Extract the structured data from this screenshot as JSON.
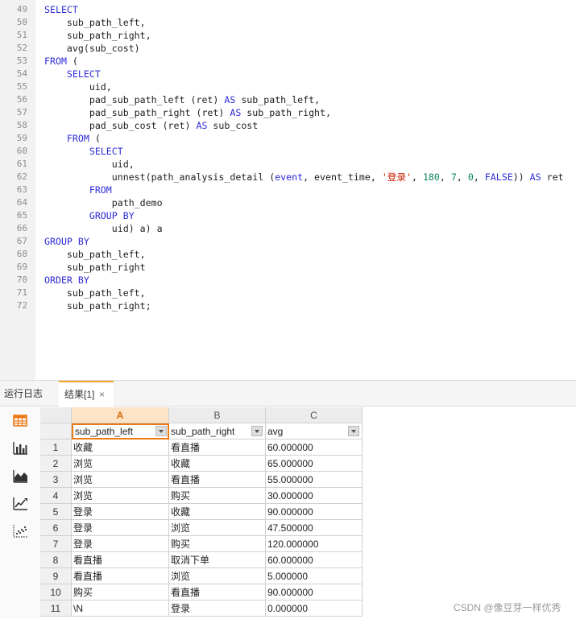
{
  "editor": {
    "lines": [
      {
        "no": "49",
        "segs": [
          {
            "t": "SELECT",
            "c": "kw"
          }
        ]
      },
      {
        "no": "50",
        "segs": [
          {
            "t": "    sub_path_left,"
          }
        ]
      },
      {
        "no": "51",
        "segs": [
          {
            "t": "    sub_path_right,"
          }
        ]
      },
      {
        "no": "52",
        "segs": [
          {
            "t": "    avg(sub_cost)"
          }
        ]
      },
      {
        "no": "53",
        "segs": [
          {
            "t": "FROM",
            "c": "kw"
          },
          {
            "t": " ("
          }
        ]
      },
      {
        "no": "54",
        "segs": [
          {
            "t": "    "
          },
          {
            "t": "SELECT",
            "c": "kw"
          }
        ]
      },
      {
        "no": "55",
        "segs": [
          {
            "t": "        uid,"
          }
        ]
      },
      {
        "no": "56",
        "segs": [
          {
            "t": "        pad_sub_path_left (ret) "
          },
          {
            "t": "AS",
            "c": "kw"
          },
          {
            "t": " sub_path_left,"
          }
        ]
      },
      {
        "no": "57",
        "segs": [
          {
            "t": "        pad_sub_path_right (ret) "
          },
          {
            "t": "AS",
            "c": "kw"
          },
          {
            "t": " sub_path_right,"
          }
        ]
      },
      {
        "no": "58",
        "segs": [
          {
            "t": "        pad_sub_cost (ret) "
          },
          {
            "t": "AS",
            "c": "kw"
          },
          {
            "t": " sub_cost"
          }
        ]
      },
      {
        "no": "59",
        "segs": [
          {
            "t": "    "
          },
          {
            "t": "FROM",
            "c": "kw"
          },
          {
            "t": " ("
          }
        ]
      },
      {
        "no": "60",
        "segs": [
          {
            "t": "        "
          },
          {
            "t": "SELECT",
            "c": "kw"
          }
        ]
      },
      {
        "no": "61",
        "segs": [
          {
            "t": "            uid,"
          }
        ]
      },
      {
        "no": "62",
        "segs": [
          {
            "t": "            unnest(path_analysis_detail ("
          },
          {
            "t": "event",
            "c": "kw"
          },
          {
            "t": ", event_time, "
          },
          {
            "t": "'登录'",
            "c": "str"
          },
          {
            "t": ", "
          },
          {
            "t": "180",
            "c": "num"
          },
          {
            "t": ", "
          },
          {
            "t": "7",
            "c": "num"
          },
          {
            "t": ", "
          },
          {
            "t": "0",
            "c": "num"
          },
          {
            "t": ", "
          },
          {
            "t": "FALSE",
            "c": "kw"
          },
          {
            "t": ")) "
          },
          {
            "t": "AS",
            "c": "kw"
          },
          {
            "t": " ret"
          }
        ]
      },
      {
        "no": "63",
        "segs": [
          {
            "t": "        "
          },
          {
            "t": "FROM",
            "c": "kw"
          }
        ]
      },
      {
        "no": "64",
        "segs": [
          {
            "t": "            path_demo"
          }
        ]
      },
      {
        "no": "65",
        "segs": [
          {
            "t": "        "
          },
          {
            "t": "GROUP BY",
            "c": "kw"
          }
        ]
      },
      {
        "no": "66",
        "segs": [
          {
            "t": "            uid) a) a"
          }
        ]
      },
      {
        "no": "67",
        "segs": [
          {
            "t": "GROUP BY",
            "c": "kw"
          }
        ]
      },
      {
        "no": "68",
        "segs": [
          {
            "t": "    sub_path_left,"
          }
        ]
      },
      {
        "no": "69",
        "segs": [
          {
            "t": "    sub_path_right"
          }
        ]
      },
      {
        "no": "70",
        "segs": [
          {
            "t": "ORDER BY",
            "c": "kw"
          }
        ]
      },
      {
        "no": "71",
        "segs": [
          {
            "t": "    sub_path_left,"
          }
        ]
      },
      {
        "no": "72",
        "segs": [
          {
            "t": "    sub_path_right;"
          }
        ]
      }
    ]
  },
  "tabs": {
    "log_label": "运行日志",
    "result_label": "结果[1]",
    "close_glyph": "×"
  },
  "sidebar": {
    "icons": [
      "table-icon",
      "bar-chart-icon",
      "area-chart-icon",
      "line-chart-icon",
      "scatter-chart-icon"
    ]
  },
  "grid": {
    "col_letters": [
      "A",
      "B",
      "C"
    ],
    "headers": [
      "sub_path_left",
      "sub_path_right",
      "avg"
    ],
    "rows": [
      [
        "1",
        "收藏",
        "看直播",
        "60.000000"
      ],
      [
        "2",
        "浏览",
        "收藏",
        "65.000000"
      ],
      [
        "3",
        "浏览",
        "看直播",
        "55.000000"
      ],
      [
        "4",
        "浏览",
        "购买",
        "30.000000"
      ],
      [
        "5",
        "登录",
        "收藏",
        "90.000000"
      ],
      [
        "6",
        "登录",
        "浏览",
        "47.500000"
      ],
      [
        "7",
        "登录",
        "购买",
        "120.000000"
      ],
      [
        "8",
        "看直播",
        "取消下单",
        "60.000000"
      ],
      [
        "9",
        "看直播",
        "浏览",
        "5.000000"
      ],
      [
        "10",
        "购买",
        "看直播",
        "90.000000"
      ],
      [
        "11",
        "\\N",
        "登录",
        "0.000000"
      ]
    ]
  },
  "colors": {
    "accent": "#ec7a14",
    "keyword": "#2b2bd8",
    "string": "#c91b00",
    "number": "#098658"
  },
  "watermark": "CSDN @像豆芽一样优秀"
}
